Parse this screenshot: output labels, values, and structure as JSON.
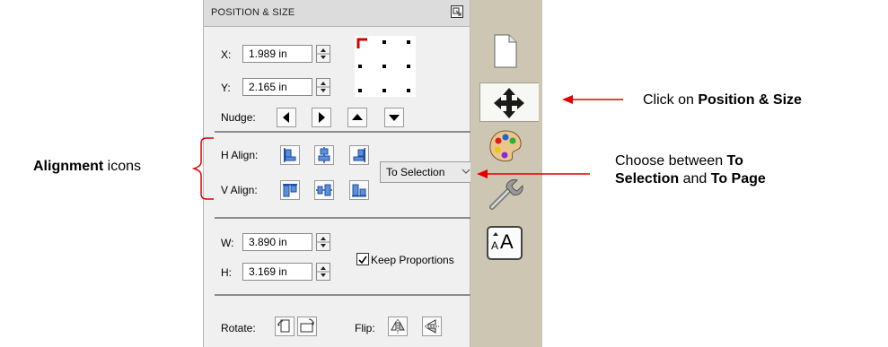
{
  "panel": {
    "title": "POSITION & SIZE",
    "x_label": "X:",
    "x_value": "1.989 in",
    "y_label": "Y:",
    "y_value": "2.165 in",
    "nudge_label": "Nudge:",
    "h_align_label": "H Align:",
    "v_align_label": "V Align:",
    "align_target": "To Selection",
    "w_label": "W:",
    "w_value": "3.890 in",
    "h_label": "H:",
    "h_value": "3.169 in",
    "keep_proportions_label": "Keep Proportions",
    "keep_proportions_checked": true,
    "rotate_label": "Rotate:",
    "flip_label": "Flip:"
  },
  "tabs": [
    {
      "icon": "page-icon"
    },
    {
      "icon": "move-arrows-icon",
      "active": true
    },
    {
      "icon": "palette-icon"
    },
    {
      "icon": "wrench-icon"
    },
    {
      "icon": "text-size-icon",
      "text": "A"
    }
  ],
  "annotations": {
    "left_bold": "Alignment",
    "left_rest": " icons",
    "right_top_prefix": "Click on ",
    "right_top_bold": "Position & Size",
    "right_bottom_prefix": "Choose between ",
    "right_bottom_bold1": "To",
    "right_bottom_bold2": "Selection",
    "right_bottom_mid": " and ",
    "right_bottom_bold3": "To Page"
  },
  "colors": {
    "annotation_red": "#e10000",
    "reference_red": "#d40000",
    "tabstrip": "#cdc6b3",
    "panel_bg": "#f0f0f0"
  }
}
